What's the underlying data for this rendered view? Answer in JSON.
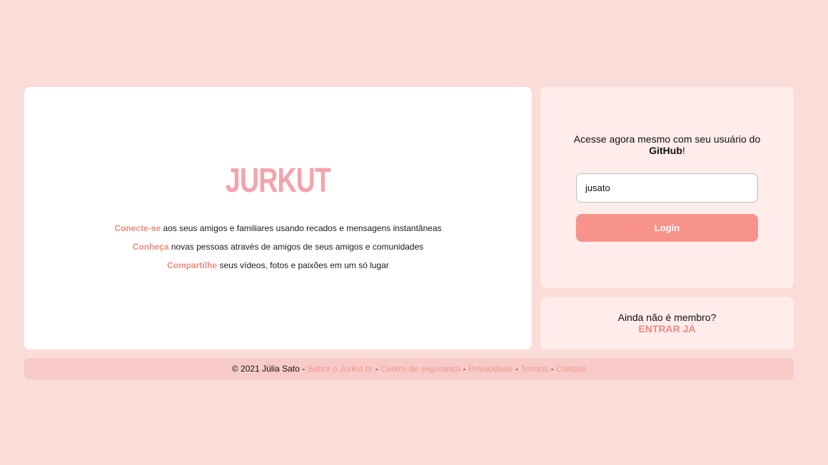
{
  "brand": {
    "logo": "JURKUT",
    "accent_color": "#f08a7f",
    "logo_color": "#f4a3ad",
    "background_color": "#fadcd9"
  },
  "taglines": [
    {
      "highlight": "Conecte-se",
      "text": " aos seus amigos e familiares usando recados e mensagens instantâneas"
    },
    {
      "highlight": "Conheça",
      "text": " novas pessoas através de amigos de seus amigos e comunidades"
    },
    {
      "highlight": "Compartilhe",
      "text": " seus vídeos, fotos e paixões em um só lugar"
    }
  ],
  "login": {
    "prompt_prefix": "Acesse agora mesmo com seu usuário do ",
    "prompt_bold": "GitHub",
    "prompt_suffix": "!",
    "username_value": "jusato",
    "button_label": "Login"
  },
  "signup": {
    "question": "Ainda não é membro?",
    "link_label": "ENTRAR JÁ"
  },
  "footer": {
    "copyright": "© 2021 Júlia Sato",
    "separator": " - ",
    "links": [
      "Sobre o Jurkut.br",
      "Centro de segurança",
      "Privacidade",
      "Termos",
      "Contato"
    ]
  }
}
